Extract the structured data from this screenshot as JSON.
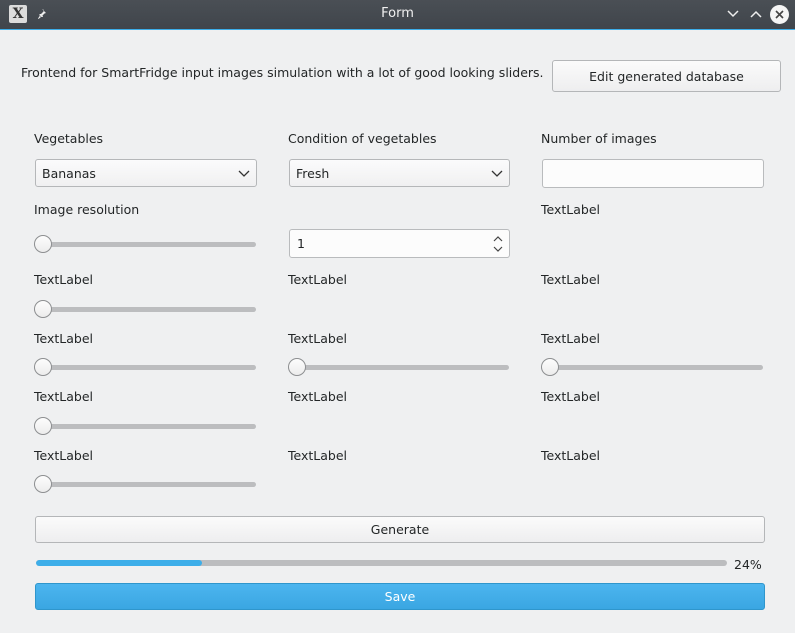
{
  "window": {
    "title": "Form"
  },
  "header": {
    "description": "Frontend for SmartFridge input images simulation with a lot of good looking sliders.",
    "edit_db_label": "Edit generated database"
  },
  "form": {
    "vegetables_label": "Vegetables",
    "vegetables_value": "Bananas",
    "condition_label": "Condition of vegetables",
    "condition_value": "Fresh",
    "num_images_label": "Number of images",
    "num_images_value": "",
    "resolution_label": "Image resolution",
    "spin_value": "1",
    "text_label": "TextLabel"
  },
  "footer": {
    "generate_label": "Generate",
    "progress_text": "24%",
    "progress_value": 0.24,
    "save_label": "Save"
  },
  "colors": {
    "accent": "#3daee9",
    "titlebar": "#454a50",
    "background": "#eff0f1"
  },
  "icons": [
    "app-icon",
    "pin-icon",
    "minimize-icon",
    "maximize-icon",
    "close-icon",
    "chevron-down-icon",
    "spin-arrows-icon"
  ]
}
